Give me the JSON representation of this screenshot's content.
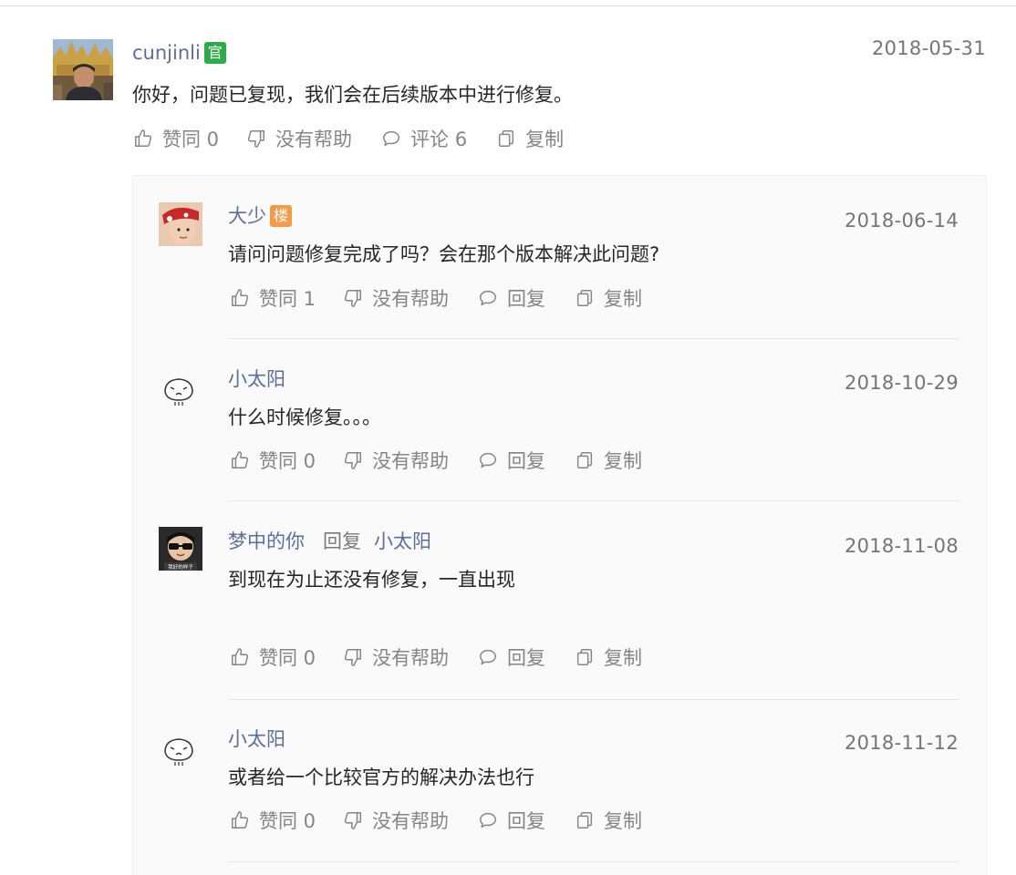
{
  "main_comment": {
    "author": "cunjinli",
    "badge": "官",
    "date": "2018-05-31",
    "text": "你好，问题已复现，我们会在后续版本中进行修复。",
    "actions": {
      "like": "赞同 0",
      "dislike": "没有帮助",
      "comment": "评论 6",
      "copy": "复制"
    }
  },
  "replies": [
    {
      "author": "大少",
      "badge": "楼",
      "date": "2018-06-14",
      "text": "请问问题修复完成了吗？会在那个版本解决此问题?",
      "actions": {
        "like": "赞同 1",
        "dislike": "没有帮助",
        "reply": "回复",
        "copy": "复制"
      }
    },
    {
      "author": "小太阳",
      "date": "2018-10-29",
      "text": "什么时候修复。。。",
      "actions": {
        "like": "赞同 0",
        "dislike": "没有帮助",
        "reply": "回复",
        "copy": "复制"
      }
    },
    {
      "author": "梦中的你",
      "reply_label": "回复",
      "reply_to": "小太阳",
      "avatar_caption": "我好的样子",
      "date": "2018-11-08",
      "text": "到现在为止还没有修复，一直出现",
      "actions": {
        "like": "赞同 0",
        "dislike": "没有帮助",
        "reply": "回复",
        "copy": "复制"
      }
    },
    {
      "author": "小太阳",
      "date": "2018-11-12",
      "text": "或者给一个比较官方的解决办法也行",
      "actions": {
        "like": "赞同 0",
        "dislike": "没有帮助",
        "reply": "回复",
        "copy": "复制"
      }
    }
  ],
  "icons": {
    "like": "thumbs-up-icon",
    "dislike": "thumbs-down-icon",
    "comment": "speech-bubble-icon",
    "copy": "copy-icon"
  },
  "colors": {
    "username": "#5d6e99",
    "official_badge": "#2faa4a",
    "op_badge": "#f49b4a",
    "action_gray": "#858585"
  }
}
